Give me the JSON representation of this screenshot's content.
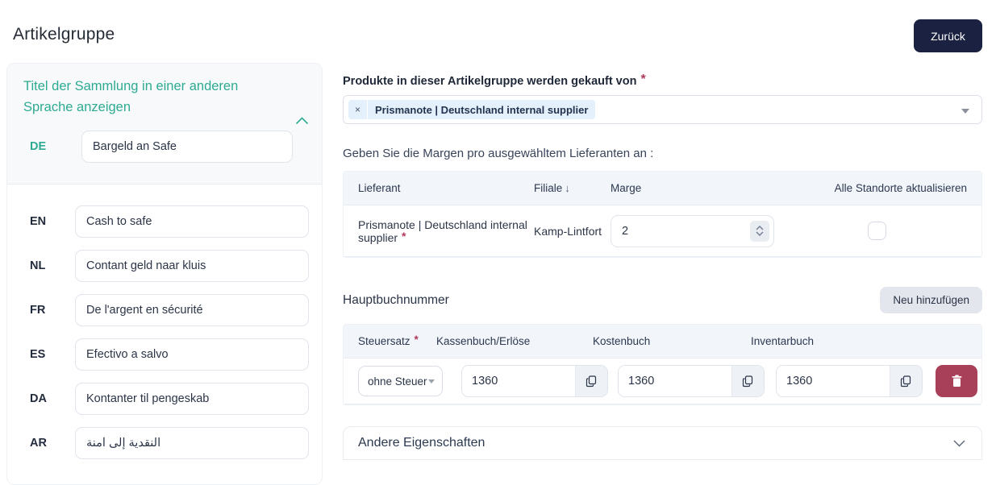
{
  "page": {
    "title": "Artikelgruppe"
  },
  "topbar": {
    "back_label": "Zurück"
  },
  "language_panel": {
    "heading": "Titel der Sammlung in einer anderen Sprache anzeigen",
    "primary": {
      "code": "DE",
      "value": "Bargeld an Safe"
    },
    "rows": [
      {
        "code": "EN",
        "value": "Cash to safe"
      },
      {
        "code": "NL",
        "value": "Contant geld naar kluis"
      },
      {
        "code": "FR",
        "value": "De l'argent en sécurité"
      },
      {
        "code": "ES",
        "value": "Efectivo a salvo"
      },
      {
        "code": "DA",
        "value": "Kontanter til pengeskab"
      },
      {
        "code": "AR",
        "value": "النقدية إلى آمنة"
      }
    ]
  },
  "supplier_section": {
    "label": "Produkte in dieser Artikelgruppe werden gekauft von",
    "required_marker": "*",
    "selected_chip": "Prismanote | Deutschland internal supplier",
    "remove_symbol": "×"
  },
  "margins_section": {
    "intro": "Geben Sie die Margen pro ausgewähltem Lieferanten an :",
    "headers": {
      "supplier": "Lieferant",
      "branch": "Filiale",
      "sort_arrow": "↓",
      "margin": "Marge",
      "update_all": "Alle Standorte aktualisieren"
    },
    "row": {
      "supplier": "Prismanote | Deutschland internal supplier",
      "required_marker": "*",
      "branch": "Kamp-Lintfort",
      "margin_value": "2",
      "update_all_checked": false
    }
  },
  "ledger_section": {
    "title": "Hauptbuchnummer",
    "add_button": "Neu hinzufügen",
    "headers": {
      "tax": "Steuersatz",
      "required_marker": "*",
      "cash": "Kassenbuch/Erlöse",
      "cost": "Kostenbuch",
      "inventory": "Inventarbuch"
    },
    "row": {
      "tax_value": "ohne Steuer",
      "cash_value": "1360",
      "cost_value": "1360",
      "inventory_value": "1360"
    }
  },
  "other_properties": {
    "title": "Andere Eigenschaften"
  },
  "colors": {
    "accent_teal": "#2dab92",
    "dark_button": "#1b2140",
    "danger": "#a9405a",
    "required": "#b03a5b",
    "chip_bg": "#e4f1fc",
    "table_header_bg": "#f2f6fa"
  }
}
